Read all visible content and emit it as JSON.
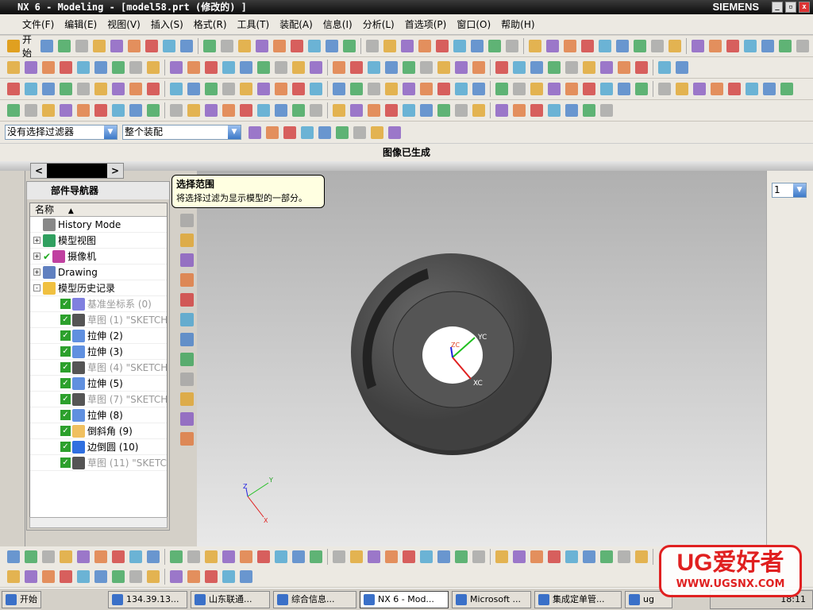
{
  "window": {
    "title": "NX 6 - Modeling - [model58.prt (修改的) ]",
    "brand": "SIEMENS"
  },
  "menu": [
    "文件(F)",
    "编辑(E)",
    "视图(V)",
    "插入(S)",
    "格式(R)",
    "工具(T)",
    "装配(A)",
    "信息(I)",
    "分析(L)",
    "首选项(P)",
    "窗口(O)",
    "帮助(H)"
  ],
  "toolbar": {
    "start_label": "开始"
  },
  "filters": {
    "type_filter": "没有选择过滤器",
    "scope": "整个装配"
  },
  "status": "图像已生成",
  "tooltip": {
    "title": "选择范围",
    "text": "将选择过滤为显示模型的一部分。"
  },
  "navigator": {
    "title": "部件导航器",
    "column": "名称",
    "items": [
      {
        "label": "History Mode",
        "icon": "clock-icon",
        "level": 0,
        "dim": false,
        "expander": ""
      },
      {
        "label": "模型视图",
        "icon": "model-view-icon",
        "level": 0,
        "dim": false,
        "expander": "+"
      },
      {
        "label": "摄像机",
        "icon": "camera-icon",
        "level": 0,
        "dim": false,
        "expander": "+",
        "checked": true
      },
      {
        "label": "Drawing",
        "icon": "drawing-icon",
        "level": 0,
        "dim": false,
        "expander": "+"
      },
      {
        "label": "模型历史记录",
        "icon": "folder-icon",
        "level": 0,
        "dim": false,
        "expander": "-"
      },
      {
        "label": "基准坐标系 (0)",
        "icon": "datum-csys-icon",
        "level": 1,
        "dim": true,
        "checked": true
      },
      {
        "label": "草图 (1) \"SKETCH_",
        "icon": "sketch-icon",
        "level": 1,
        "dim": true,
        "checked": true
      },
      {
        "label": "拉伸 (2)",
        "icon": "extrude-icon",
        "level": 1,
        "dim": false,
        "checked": true
      },
      {
        "label": "拉伸 (3)",
        "icon": "extrude-icon",
        "level": 1,
        "dim": false,
        "checked": true
      },
      {
        "label": "草图 (4) \"SKETCH_",
        "icon": "sketch-icon",
        "level": 1,
        "dim": true,
        "checked": true
      },
      {
        "label": "拉伸 (5)",
        "icon": "extrude-icon",
        "level": 1,
        "dim": false,
        "checked": true
      },
      {
        "label": "草图 (7) \"SKETCH_",
        "icon": "sketch-icon",
        "level": 1,
        "dim": true,
        "checked": true
      },
      {
        "label": "拉伸 (8)",
        "icon": "extrude-icon",
        "level": 1,
        "dim": false,
        "checked": true
      },
      {
        "label": "倒斜角 (9)",
        "icon": "chamfer-icon",
        "level": 1,
        "dim": false,
        "checked": true
      },
      {
        "label": "边倒圆 (10)",
        "icon": "edge-blend-icon",
        "level": 1,
        "dim": false,
        "checked": true
      },
      {
        "label": "草图 (11) \"SKETCH_",
        "icon": "sketch-icon",
        "level": 1,
        "dim": true,
        "checked": true
      }
    ]
  },
  "viewport": {
    "axes": {
      "x": "XC",
      "y": "YC",
      "z": "ZC"
    },
    "triad": {
      "x": "X",
      "y": "Y",
      "z": "Z"
    },
    "layer": "1"
  },
  "taskbar": {
    "start": "开始",
    "tasks": [
      "134.39.13...",
      "山东联通...",
      "综合信息...",
      "NX 6 - Mod...",
      "Microsoft ...",
      "集成定单管...",
      "ug"
    ],
    "active": 3,
    "clock": "18:11"
  },
  "watermark": {
    "logo": "UG爱好者",
    "url": "WWW.UGSNX.COM"
  },
  "colors": {
    "accent": "#3d79c8",
    "part": "#505050",
    "tooltip": "#ffffe1"
  }
}
